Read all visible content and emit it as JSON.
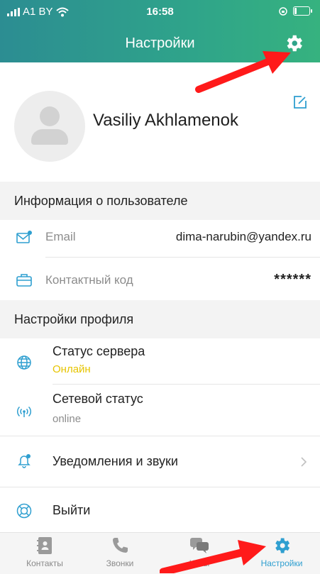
{
  "status_bar": {
    "carrier": "A1 BY",
    "time": "16:58"
  },
  "header": {
    "title": "Настройки"
  },
  "profile": {
    "name": "Vasiliy Akhlamenok"
  },
  "user_info": {
    "section_title": "Информация о пользователе",
    "email_label": "Email",
    "email_value": "dima-narubin@yandex.ru",
    "code_label": "Контактный код",
    "code_value": "******"
  },
  "profile_settings": {
    "section_title": "Настройки профиля",
    "server_status_label": "Статус сервера",
    "server_status_value": "Онлайн",
    "network_status_label": "Сетевой статус",
    "network_status_value": "online",
    "notifications_label": "Уведомления и звуки",
    "logout_label": "Выйти"
  },
  "tabbar": {
    "contacts": "Контакты",
    "calls": "Звонки",
    "chats": "Чаты",
    "settings": "Настройки"
  },
  "colors": {
    "accent": "#2f9fd0",
    "online": "#e6c400",
    "header_start": "#2c8d92",
    "header_end": "#36b27f",
    "annotation": "#ff1a1a"
  },
  "icons": {
    "header_settings": "gear-icon",
    "edit": "edit-icon",
    "email": "mail-icon",
    "code": "briefcase-icon",
    "server": "globe-icon",
    "network": "antenna-icon",
    "notifications": "bell-icon",
    "logout": "lifebuoy-icon",
    "chevron": "chevron-right-icon"
  }
}
